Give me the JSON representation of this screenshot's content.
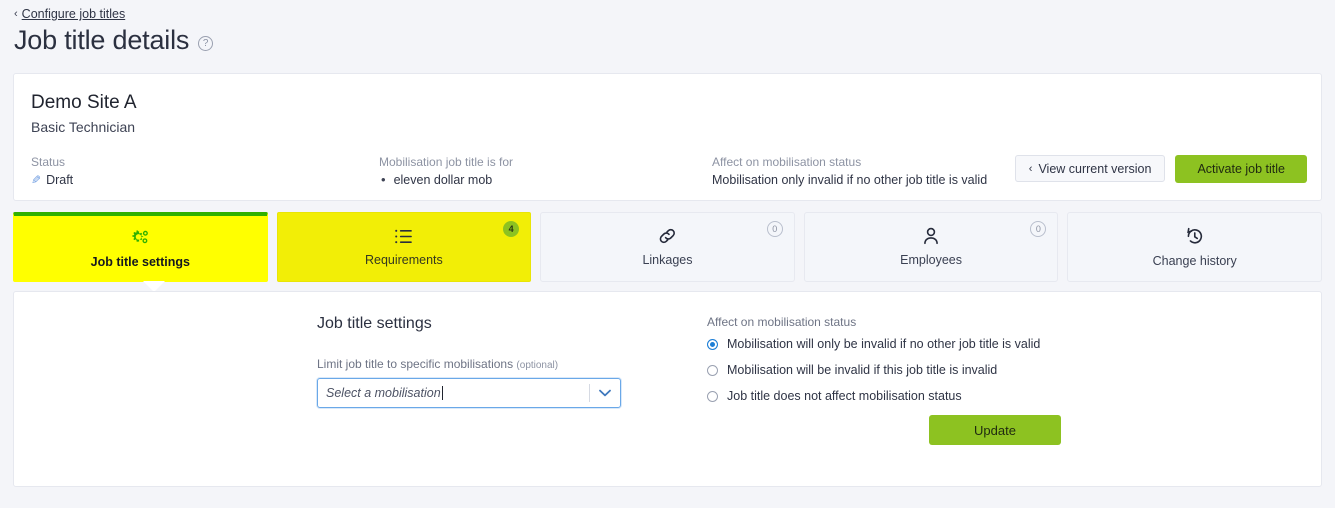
{
  "breadcrumb": {
    "back_chevron": "chevron-left-icon",
    "label": "Configure job titles"
  },
  "header": {
    "title": "Job title details",
    "help_icon": "question-mark-icon"
  },
  "record": {
    "site_name": "Demo Site A",
    "job_title": "Basic Technician",
    "fields": [
      {
        "label": "Status",
        "value": "Draft",
        "icon": "pencil-icon"
      },
      {
        "label": "Mobilisation job title is for",
        "value": "eleven dollar mob"
      },
      {
        "label": "Affect on mobilisation status",
        "value": "Mobilisation only invalid if no other job title is valid"
      }
    ],
    "buttons": {
      "view_current_version": "View current version",
      "view_current_version_chevron": "‹",
      "activate": "Activate job title"
    }
  },
  "tabs": [
    {
      "label": "Job title settings",
      "icon": "gears-icon",
      "badge": null,
      "state": "active-highlighted"
    },
    {
      "label": "Requirements",
      "icon": "list-icon",
      "badge": "4",
      "badge_type": "count",
      "state": "highlighted"
    },
    {
      "label": "Linkages",
      "icon": "link-icon",
      "badge": "0",
      "badge_type": "zero",
      "state": "default"
    },
    {
      "label": "Employees",
      "icon": "person-icon",
      "badge": "0",
      "badge_type": "zero",
      "state": "default"
    },
    {
      "label": "Change history",
      "icon": "history-icon",
      "badge": null,
      "state": "default"
    }
  ],
  "settings": {
    "section_title": "Job title settings",
    "mobilisation_field": {
      "label": "Limit job title to specific mobilisations",
      "optional_suffix": "(optional)",
      "placeholder": "Select a mobilisation",
      "value": "",
      "dropdown_icon": "chevron-down-icon"
    },
    "affect_status": {
      "label": "Affect on mobilisation status",
      "options": [
        {
          "label": "Mobilisation will only be invalid if no other job title is valid",
          "selected": true
        },
        {
          "label": "Mobilisation will be invalid if this job title is invalid",
          "selected": false
        },
        {
          "label": "Job title does not affect mobilisation status",
          "selected": false
        }
      ]
    },
    "update_button": "Update"
  },
  "colors": {
    "brand_green": "#8dc221",
    "highlight_yellow": "#ffff00",
    "accent_blue": "#1c7ed6",
    "page_background": "#f4f5f9"
  }
}
